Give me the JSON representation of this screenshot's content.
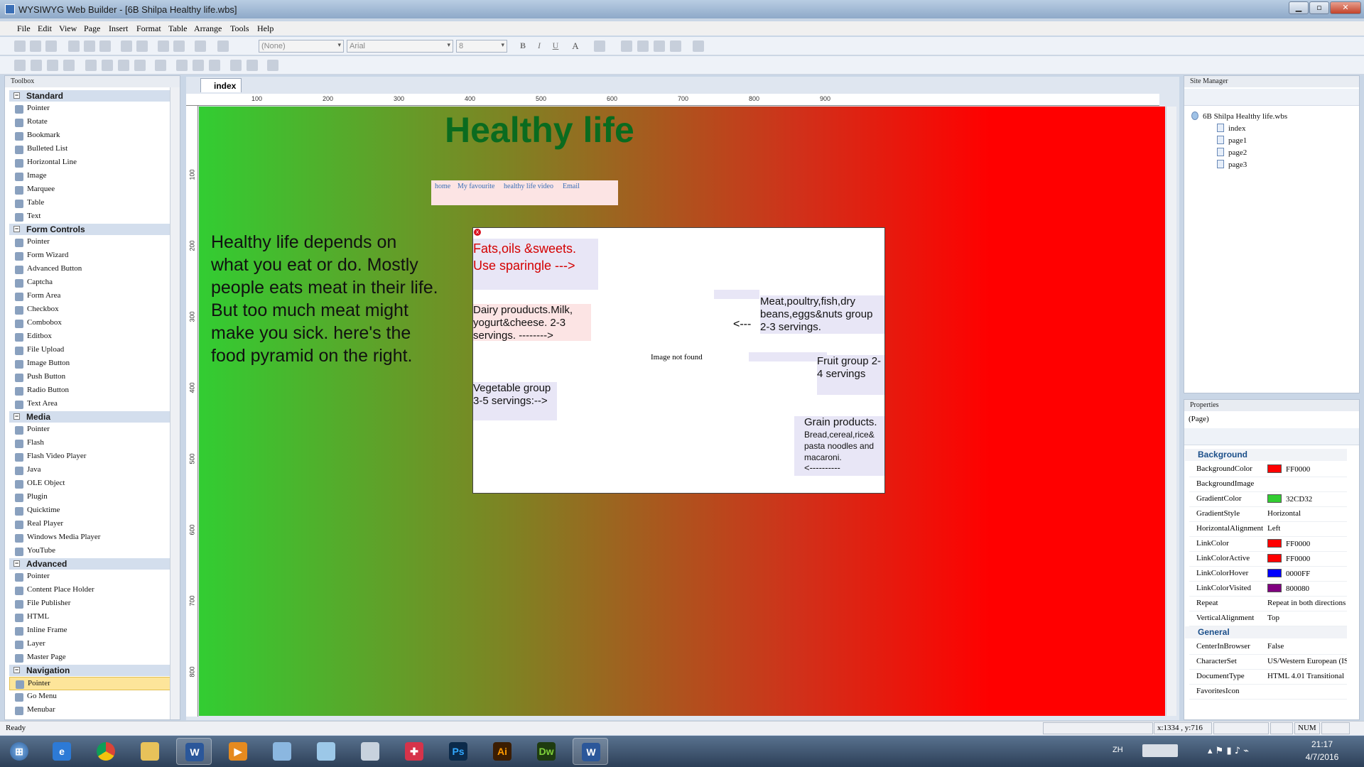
{
  "window": {
    "title": "WYSIWYG Web Builder - [6B Shilpa Healthy life.wbs]"
  },
  "menu": [
    "File",
    "Edit",
    "View",
    "Page",
    "Insert",
    "Format",
    "Table",
    "Arrange",
    "Tools",
    "Help"
  ],
  "format_toolbar": {
    "style": "(None)",
    "font": "Arial",
    "size": "8"
  },
  "toolbox": {
    "title": "Toolbox",
    "sections": [
      {
        "name": "Standard",
        "items": [
          "Pointer",
          "Rotate",
          "Bookmark",
          "Bulleted List",
          "Horizontal Line",
          "Image",
          "Marquee",
          "Table",
          "Text"
        ]
      },
      {
        "name": "Form Controls",
        "items": [
          "Pointer",
          "Form Wizard",
          "Advanced Button",
          "Captcha",
          "Form Area",
          "Checkbox",
          "Combobox",
          "Editbox",
          "File Upload",
          "Image Button",
          "Push Button",
          "Radio Button",
          "Text Area"
        ]
      },
      {
        "name": "Media",
        "items": [
          "Pointer",
          "Flash",
          "Flash Video Player",
          "Java",
          "OLE Object",
          "Plugin",
          "Quicktime",
          "Real Player",
          "Windows Media Player",
          "YouTube"
        ]
      },
      {
        "name": "Advanced",
        "items": [
          "Pointer",
          "Content Place Holder",
          "File Publisher",
          "HTML",
          "Inline Frame",
          "Layer",
          "Master Page"
        ]
      },
      {
        "name": "Navigation",
        "items": [
          "Pointer",
          "Go Menu",
          "Menubar"
        ]
      }
    ]
  },
  "editor": {
    "tab": "index",
    "ruler_h": [
      "100",
      "200",
      "300",
      "400",
      "500",
      "600",
      "700",
      "800",
      "900"
    ],
    "ruler_v": [
      "100",
      "200",
      "300",
      "400",
      "500",
      "600",
      "700",
      "800"
    ]
  },
  "page": {
    "title": "Healthy life",
    "nav": [
      "home",
      "My favourite",
      "healthy life video",
      "Email"
    ],
    "intro": "Healthy life depends on what you eat or do. Mostly people eats meat in their life. But too much meat might make you sick. here's the food pyramid on the right.",
    "image_alt": "Image not found",
    "labels": {
      "fats": "Fats,oils &sweets. Use sparingle  --->",
      "dairy": "Dairy prouducts.Milk, yogurt&cheese. 2-3 servings.  -------->",
      "meat_arrow": "<---",
      "meat": "Meat,poultry,fish,dry beans,eggs&nuts group 2-3 servings.",
      "fruit": "Fruit group 2-4 servings",
      "vegetable": "Vegetable group 3-5 servings:-->",
      "grain_title": "Grain products.",
      "grain_body": "Bread,cereal,rice& pasta noodles and macaroni.",
      "grain_arrow": "<----------"
    }
  },
  "site_manager": {
    "title": "Site Manager",
    "root": "6B Shilpa Healthy life.wbs",
    "pages": [
      "index",
      "page1",
      "page2",
      "page3"
    ]
  },
  "properties": {
    "title": "Properties",
    "object": "(Page)",
    "categories": [
      {
        "name": "Background",
        "rows": [
          {
            "key": "BackgroundColor",
            "value": "FF0000",
            "color": "#FF0000"
          },
          {
            "key": "BackgroundImage",
            "value": ""
          },
          {
            "key": "GradientColor",
            "value": "32CD32",
            "color": "#32CD32"
          },
          {
            "key": "GradientStyle",
            "value": "Horizontal"
          },
          {
            "key": "HorizontalAlignment",
            "value": "Left"
          },
          {
            "key": "LinkColor",
            "value": "FF0000",
            "color": "#FF0000"
          },
          {
            "key": "LinkColorActive",
            "value": "FF0000",
            "color": "#FF0000"
          },
          {
            "key": "LinkColorHover",
            "value": "0000FF",
            "color": "#0000FF"
          },
          {
            "key": "LinkColorVisited",
            "value": "800080",
            "color": "#800080"
          },
          {
            "key": "Repeat",
            "value": "Repeat in both directions"
          },
          {
            "key": "VerticalAlignment",
            "value": "Top"
          }
        ]
      },
      {
        "name": "General",
        "rows": [
          {
            "key": "CenterInBrowser",
            "value": "False"
          },
          {
            "key": "CharacterSet",
            "value": "US/Western European (ISO)"
          },
          {
            "key": "DocumentType",
            "value": "HTML 4.01 Transitional"
          },
          {
            "key": "FavoritesIcon",
            "value": ""
          }
        ]
      }
    ]
  },
  "status": {
    "ready": "Ready",
    "coords": "x:1334 , y:716",
    "num": "NUM"
  },
  "taskbar": {
    "lang": "ZH",
    "time": "21:17",
    "date": "4/7/2016"
  }
}
